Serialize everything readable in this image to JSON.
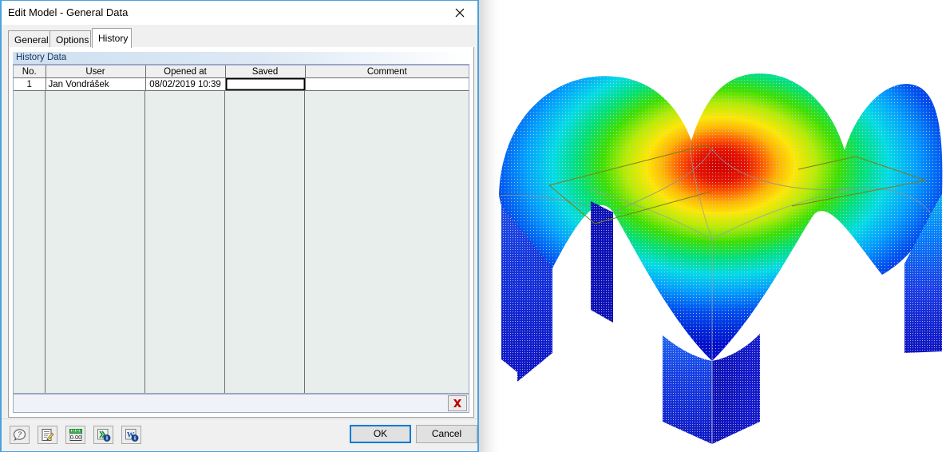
{
  "window": {
    "title": "Edit Model - General Data",
    "close_icon": "close-icon"
  },
  "tabs": [
    {
      "id": "general",
      "label": "General",
      "active": false
    },
    {
      "id": "options",
      "label": "Options",
      "active": false
    },
    {
      "id": "history",
      "label": "History",
      "active": true
    }
  ],
  "group": {
    "label": "History Data"
  },
  "table": {
    "columns": [
      "No.",
      "User",
      "Opened at",
      "Saved",
      "Comment"
    ],
    "rows": [
      {
        "no": "1",
        "user": "Jan Vondrášek",
        "opened_at": "08/02/2019 10:39",
        "saved": "",
        "comment": ""
      }
    ],
    "selected_cell": "saved",
    "delete_button": {
      "name": "delete-row-button",
      "icon": "red-x-icon",
      "color": "#c00000"
    }
  },
  "toolbar": [
    {
      "id": "help",
      "icon": "help-icon",
      "title": "Help"
    },
    {
      "id": "edit",
      "icon": "edit-note-icon",
      "title": "Edit"
    },
    {
      "id": "units",
      "icon": "units-ruler-icon",
      "title": "Units and Decimal Places"
    },
    {
      "id": "export-excel",
      "icon": "excel-export-icon",
      "title": "Export to MS Excel"
    },
    {
      "id": "export-word",
      "icon": "word-export-icon",
      "title": "Export to MS Word"
    }
  ],
  "buttons": {
    "ok": "OK",
    "cancel": "Cancel"
  },
  "colors": {
    "accent_border": "#4aa3df",
    "focus_blue": "#0078d7",
    "group_header_text": "#17365d",
    "grid_fill": "#e8eeec"
  },
  "viewport": {
    "name": "fea-result-3d-view",
    "description": "Shell structure deformation / stress contour plot",
    "contour_colors": [
      "#0000d0",
      "#0040ff",
      "#0090ff",
      "#00d8f0",
      "#00e0a0",
      "#40e000",
      "#b8e800",
      "#ffe000",
      "#ff9000",
      "#ff3000",
      "#d00000"
    ],
    "wireframe_color": "#808000",
    "mesh_color": "#b0b0b0"
  }
}
